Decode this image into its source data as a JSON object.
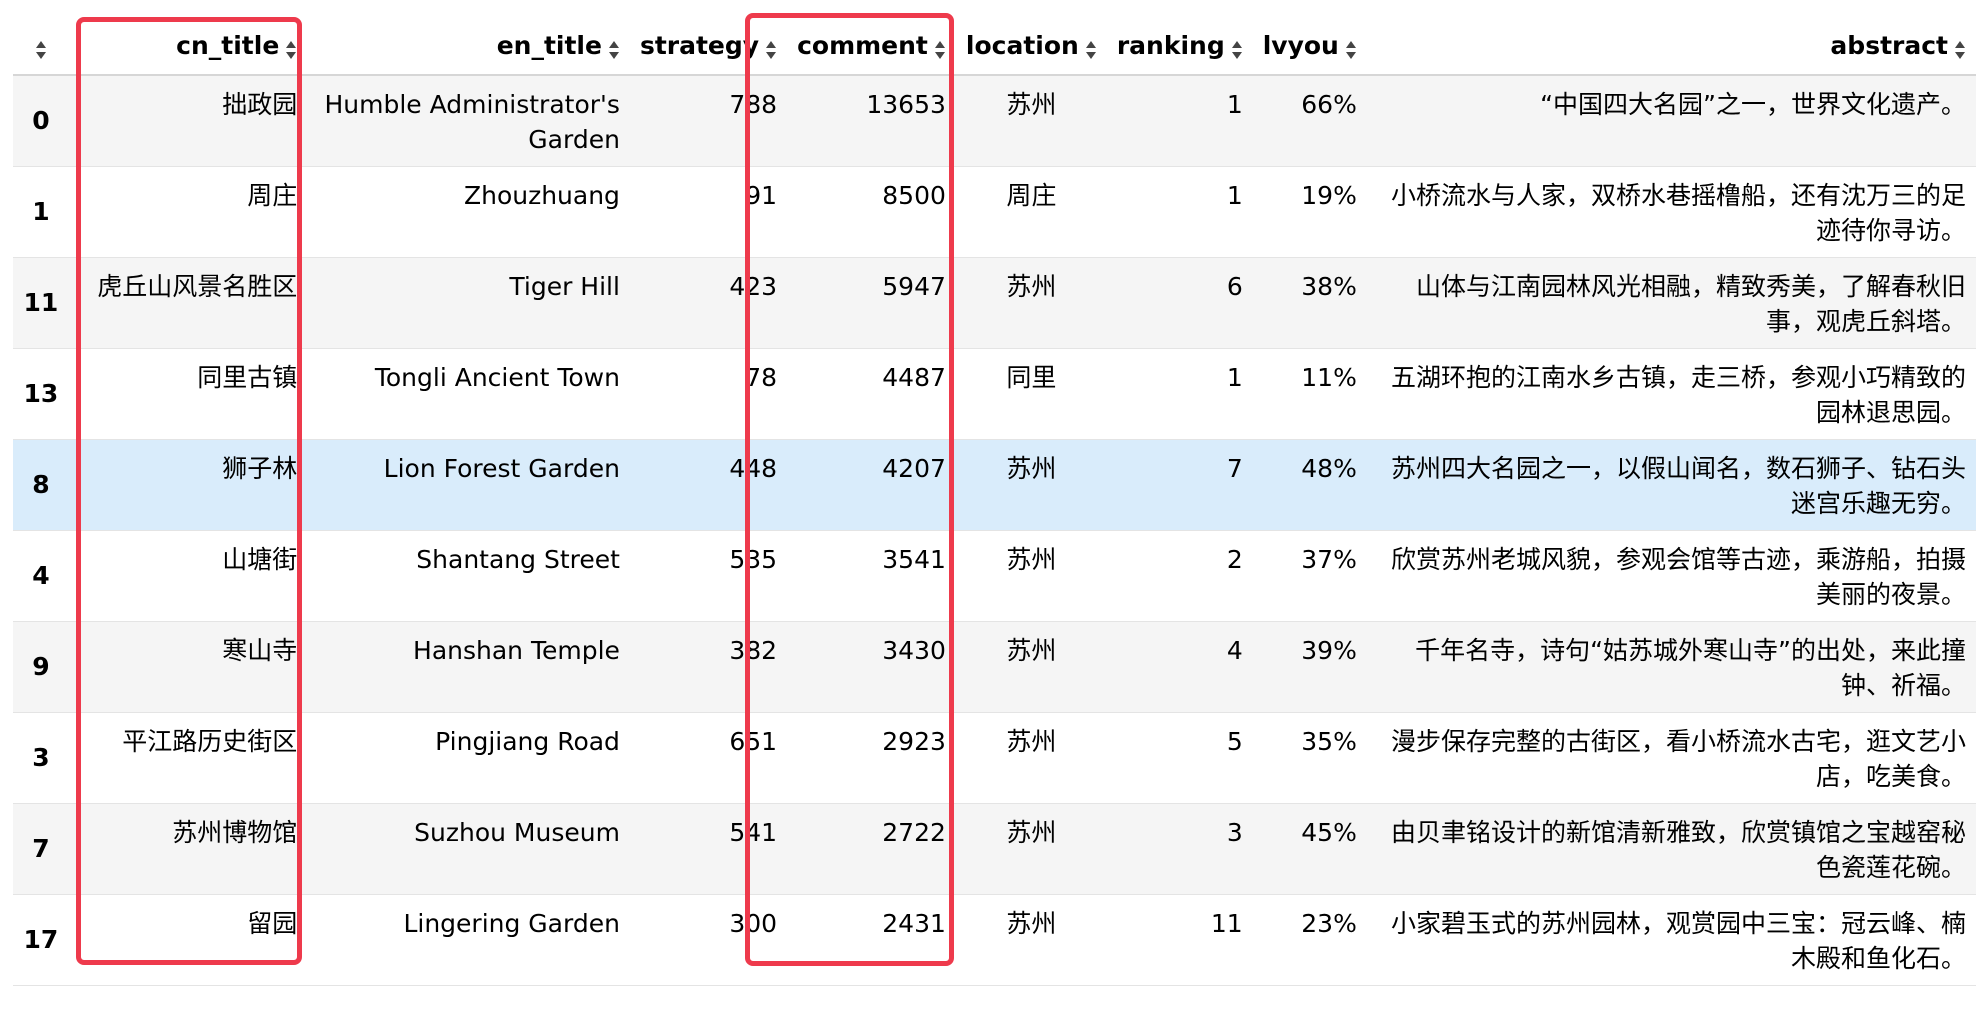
{
  "table": {
    "columns": [
      {
        "key": "index",
        "label": ""
      },
      {
        "key": "cn_title",
        "label": "cn_title"
      },
      {
        "key": "en_title",
        "label": "en_title"
      },
      {
        "key": "strategy",
        "label": "strategy"
      },
      {
        "key": "comment",
        "label": "comment"
      },
      {
        "key": "location",
        "label": "location"
      },
      {
        "key": "ranking",
        "label": "ranking"
      },
      {
        "key": "lvyou",
        "label": "lvyou"
      },
      {
        "key": "abstract",
        "label": "abstract"
      }
    ],
    "rows": [
      {
        "index": "0",
        "cn_title": "拙政园",
        "en_title": "Humble Administrator's Garden",
        "strategy": "788",
        "comment": "13653",
        "location": "苏州",
        "ranking": "1",
        "lvyou": "66%",
        "abstract": "“中国四大名园”之一，世界文化遗产。"
      },
      {
        "index": "1",
        "cn_title": "周庄",
        "en_title": "Zhouzhuang",
        "strategy": "91",
        "comment": "8500",
        "location": "周庄",
        "ranking": "1",
        "lvyou": "19%",
        "abstract": "小桥流水与人家，双桥水巷摇橹船，还有沈万三的足迹待你寻访。"
      },
      {
        "index": "11",
        "cn_title": "虎丘山风景名胜区",
        "en_title": "Tiger Hill",
        "strategy": "423",
        "comment": "5947",
        "location": "苏州",
        "ranking": "6",
        "lvyou": "38%",
        "abstract": "山体与江南园林风光相融，精致秀美，了解春秋旧事，观虎丘斜塔。"
      },
      {
        "index": "13",
        "cn_title": "同里古镇",
        "en_title": "Tongli Ancient Town",
        "strategy": "78",
        "comment": "4487",
        "location": "同里",
        "ranking": "1",
        "lvyou": "11%",
        "abstract": "五湖环抱的江南水乡古镇，走三桥，参观小巧精致的园林退思园。"
      },
      {
        "index": "8",
        "cn_title": "狮子林",
        "en_title": "Lion Forest Garden",
        "strategy": "448",
        "comment": "4207",
        "location": "苏州",
        "ranking": "7",
        "lvyou": "48%",
        "abstract": "苏州四大名园之一，以假山闻名，数石狮子、钻石头迷宫乐趣无穷。"
      },
      {
        "index": "4",
        "cn_title": "山塘街",
        "en_title": "Shantang Street",
        "strategy": "535",
        "comment": "3541",
        "location": "苏州",
        "ranking": "2",
        "lvyou": "37%",
        "abstract": "欣赏苏州老城风貌，参观会馆等古迹，乘游船，拍摄美丽的夜景。"
      },
      {
        "index": "9",
        "cn_title": "寒山寺",
        "en_title": "Hanshan Temple",
        "strategy": "382",
        "comment": "3430",
        "location": "苏州",
        "ranking": "4",
        "lvyou": "39%",
        "abstract": "千年名寺，诗句“姑苏城外寒山寺”的出处，来此撞钟、祈福。"
      },
      {
        "index": "3",
        "cn_title": "平江路历史街区",
        "en_title": "Pingjiang Road",
        "strategy": "651",
        "comment": "2923",
        "location": "苏州",
        "ranking": "5",
        "lvyou": "35%",
        "abstract": "漫步保存完整的古街区，看小桥流水古宅，逛文艺小店，吃美食。"
      },
      {
        "index": "7",
        "cn_title": "苏州博物馆",
        "en_title": "Suzhou Museum",
        "strategy": "541",
        "comment": "2722",
        "location": "苏州",
        "ranking": "3",
        "lvyou": "45%",
        "abstract": "由贝聿铭设计的新馆清新雅致，欣赏镇馆之宝越窑秘色瓷莲花碗。"
      },
      {
        "index": "17",
        "cn_title": "留园",
        "en_title": "Lingering Garden",
        "strategy": "300",
        "comment": "2431",
        "location": "苏州",
        "ranking": "11",
        "lvyou": "23%",
        "abstract": "小家碧玉式的苏州园林，观赏园中三宝：冠云峰、楠木殿和鱼化石。"
      }
    ],
    "highlighted_row": 4
  },
  "colors": {
    "highlight_box": "#ee3a4c",
    "row_hover": "#d9ecfb",
    "row_stripe": "#f5f5f5"
  },
  "icons": {
    "sort": "sort-icon",
    "highlighted_columns": [
      "cn_title",
      "comment"
    ]
  }
}
